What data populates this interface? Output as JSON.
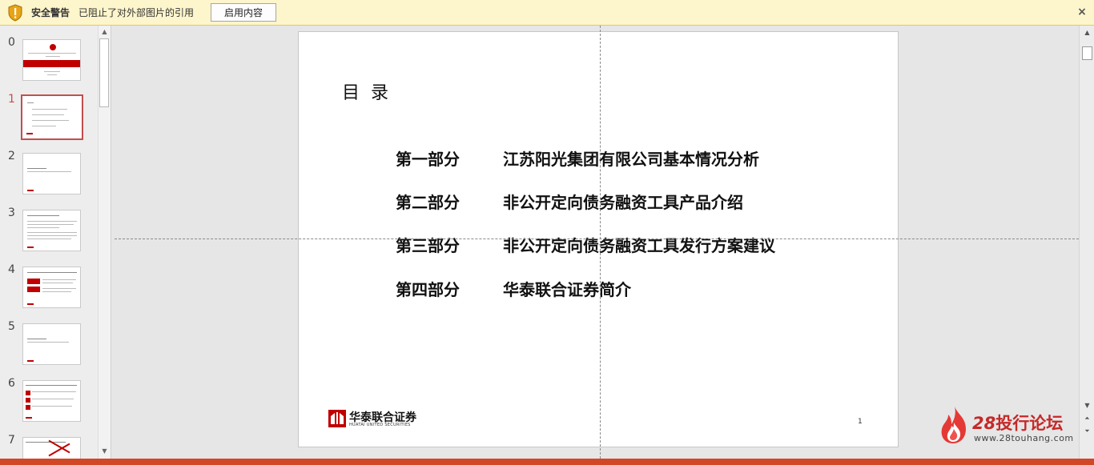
{
  "security_bar": {
    "title": "安全警告",
    "message": "已阻止了对外部图片的引用",
    "enable_button": "启用内容",
    "close_glyph": "×"
  },
  "thumbnails": {
    "items": [
      {
        "number": "0"
      },
      {
        "number": "1",
        "active": true
      },
      {
        "number": "2"
      },
      {
        "number": "3"
      },
      {
        "number": "4"
      },
      {
        "number": "5"
      },
      {
        "number": "6"
      },
      {
        "number": "7"
      }
    ]
  },
  "slide": {
    "title": "目录",
    "toc": [
      {
        "label": "第一部分",
        "text": "江苏阳光集团有限公司基本情况分析"
      },
      {
        "label": "第二部分",
        "text": "非公开定向债务融资工具产品介绍"
      },
      {
        "label": "第三部分",
        "text": "非公开定向债务融资工具发行方案建议"
      },
      {
        "label": "第四部分",
        "text": "华泰联合证券简介"
      }
    ],
    "logo_cn": "华泰联合证券",
    "logo_en": "HUATAI UNITED SECURITIES",
    "page_number": "1"
  },
  "watermark": {
    "number": "28",
    "name": "投行论坛",
    "url": "www.28touhang.com"
  },
  "colors": {
    "accent": "#c0504d",
    "status_bar": "#d24726",
    "warning_bg": "#fdf5cc",
    "watermark_red": "#c62828"
  }
}
